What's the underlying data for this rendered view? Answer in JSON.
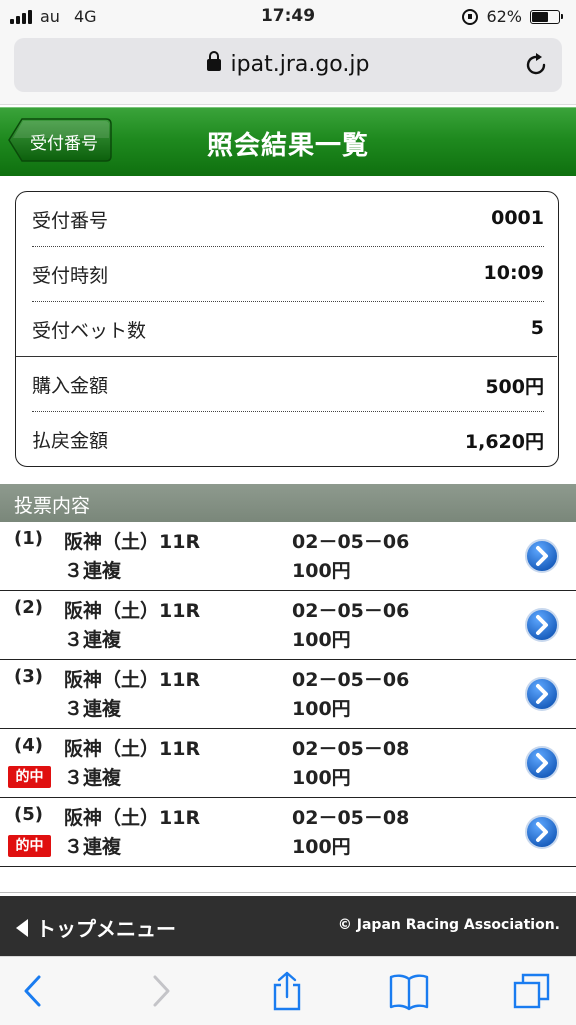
{
  "status_bar": {
    "carrier": "au",
    "network": "4G",
    "time": "17:49",
    "battery_percent": "62%",
    "battery_level": 0.62
  },
  "browser": {
    "url": "ipat.jra.go.jp"
  },
  "header": {
    "back_label": "受付番号",
    "title": "照会結果一覧"
  },
  "receipt": {
    "rows": [
      {
        "label": "受付番号",
        "value": "0001"
      },
      {
        "label": "受付時刻",
        "value": "10:09"
      },
      {
        "label": "受付ベット数",
        "value": "5"
      },
      {
        "label": "購入金額",
        "value": "500円"
      },
      {
        "label": "払戻金額",
        "value": "1,620円"
      }
    ]
  },
  "section": {
    "title": "投票内容"
  },
  "bets": [
    {
      "num": "(1)",
      "race": "阪神（土）11R",
      "type": "３連複",
      "combo": "02－05－06",
      "amount": "100円",
      "hit": ""
    },
    {
      "num": "(2)",
      "race": "阪神（土）11R",
      "type": "３連複",
      "combo": "02－05－06",
      "amount": "100円",
      "hit": ""
    },
    {
      "num": "(3)",
      "race": "阪神（土）11R",
      "type": "３連複",
      "combo": "02－05－06",
      "amount": "100円",
      "hit": ""
    },
    {
      "num": "(4)",
      "race": "阪神（土）11R",
      "type": "３連複",
      "combo": "02－05－08",
      "amount": "100円",
      "hit": "的中"
    },
    {
      "num": "(5)",
      "race": "阪神（土）11R",
      "type": "３連複",
      "combo": "02－05－08",
      "amount": "100円",
      "hit": "的中"
    }
  ],
  "footer": {
    "top_menu": "トップメニュー",
    "copyright": "© Japan Racing Association."
  },
  "colors": {
    "header_green": "#1f8a1f",
    "hit_red": "#e01010",
    "arrow_blue": "#1e6fd0",
    "footer_bg": "#2f2f2f"
  },
  "icons": {
    "detail_arrow": "chevron-right-circle-icon",
    "back": "back-chevron-icon",
    "share": "share-icon",
    "bookmarks": "book-icon",
    "tabs": "tabs-icon",
    "reload": "reload-icon"
  }
}
